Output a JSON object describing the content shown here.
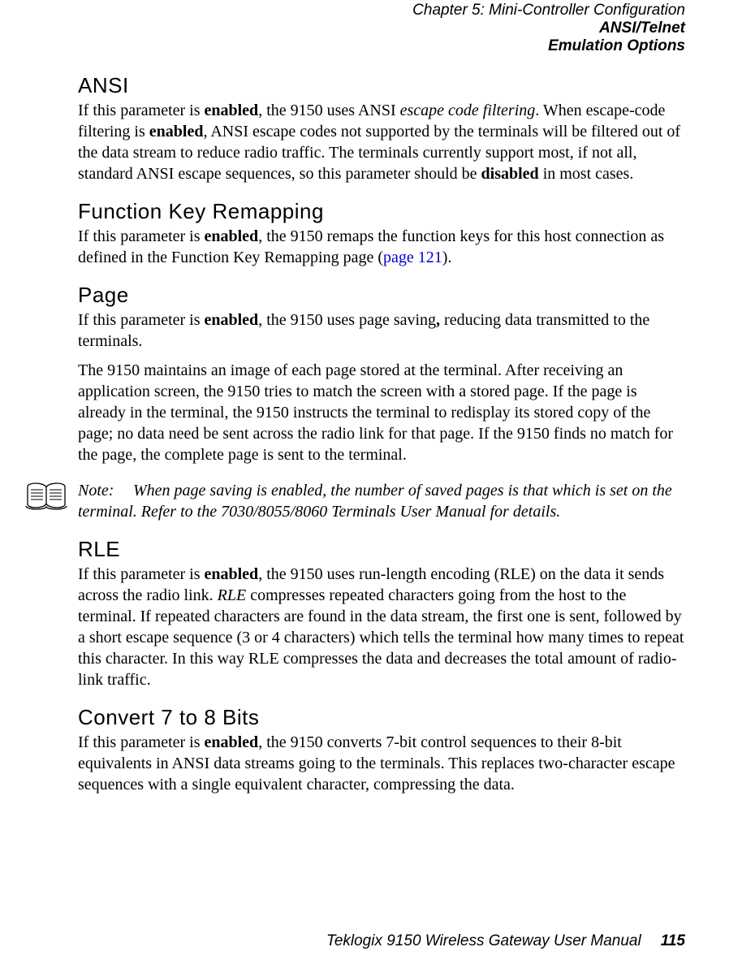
{
  "header": {
    "chapter": "Chapter 5:  Mini-Controller Configuration",
    "sub1": "ANSI/Telnet",
    "sub2": "Emulation Options"
  },
  "sections": {
    "ansi": {
      "title": "ANSI",
      "p1_a": "If this parameter is ",
      "p1_b": "enabled",
      "p1_c": ", the 9150 uses ANSI ",
      "p1_d": "escape code filtering",
      "p1_e": ". When escape-code filtering is ",
      "p1_f": "enabled",
      "p1_g": ", ANSI escape codes not supported by the terminals will be filtered out of the data stream to reduce radio traffic. The terminals currently support most, if not all, standard ANSI escape sequences, so this parame­ter should be ",
      "p1_h": "disabled",
      "p1_i": " in most cases."
    },
    "fkey": {
      "title": "Function Key Remapping",
      "p1_a": "If this parameter is ",
      "p1_b": "enabled",
      "p1_c": ", the 9150 remaps the function keys for this host connection as defined in the Function Key Remapping page (",
      "p1_link": "page 121",
      "p1_d": ")."
    },
    "page": {
      "title": "Page",
      "p1_a": "If this parameter is ",
      "p1_b": "enabled",
      "p1_c": ", the 9150 uses page saving",
      "p1_comma": ",",
      "p1_d": " reducing data transmitted to the terminals.",
      "p2": "The 9150 maintains an image of each page stored at the terminal. After receiving an application screen, the 9150 tries to match the screen with a stored page. If the page is already in the terminal, the 9150 instructs the terminal to redisplay its stored copy of the page; no data need be sent across the radio link for that page. If the 9150 finds no match for the page, the complete page is sent to the terminal."
    },
    "note": {
      "label": "Note:",
      "body": "When page saving is enabled, the number of saved pages is that which is set on the terminal. Refer to the 7030/8055/8060 Terminals User Manual for details."
    },
    "rle": {
      "title": "RLE",
      "p1_a": "If this parameter is ",
      "p1_b": "enabled",
      "p1_c": ", the 9150 uses run-length encoding (RLE) on the data it sends across the radio link. ",
      "p1_d": "RLE",
      "p1_e": " compresses repeated characters going from the host to the terminal. If repeated characters are found in the data stream, the first one is sent, followed by a short escape sequence (3 or 4 characters) which tells the terminal how many times to repeat this character. In this way RLE compresses the data and decreases the total amount of radio-link traffic."
    },
    "convert": {
      "title": "Convert 7 to 8 Bits",
      "p1_a": "If this parameter is ",
      "p1_b": "enabled",
      "p1_c": ", the 9150 converts 7-bit control sequences to their 8-bit equivalents in ANSI data streams going to the terminals. This replaces two-charac­ter escape sequences with a single equivalent character, compressing the data."
    }
  },
  "footer": {
    "book": "Teklogix 9150 Wireless Gateway User Manual",
    "page": "115"
  }
}
